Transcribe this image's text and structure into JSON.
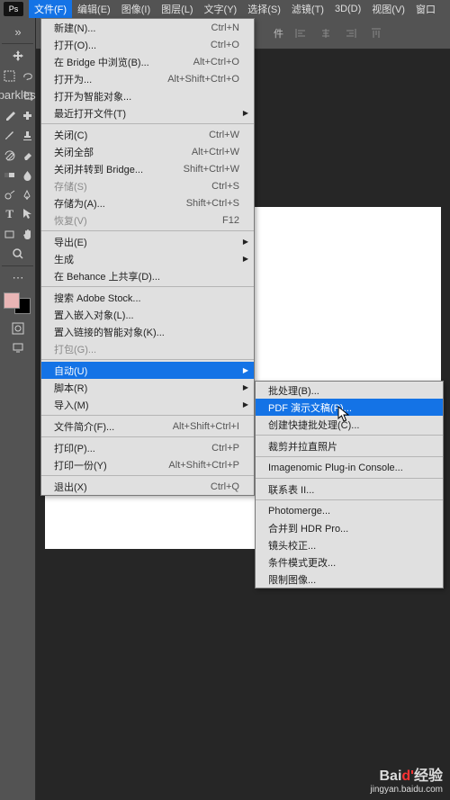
{
  "menubar": {
    "logo": "Ps",
    "items": [
      "文件(F)",
      "编辑(E)",
      "图像(I)",
      "图层(L)",
      "文字(Y)",
      "选择(S)",
      "滤镜(T)",
      "3D(D)",
      "视图(V)",
      "窗口"
    ]
  },
  "toolbar": {
    "chinese_label": "件"
  },
  "file_menu": {
    "new": {
      "label": "新建(N)...",
      "sc": "Ctrl+N"
    },
    "open": {
      "label": "打开(O)...",
      "sc": "Ctrl+O"
    },
    "browse_bridge": {
      "label": "在 Bridge 中浏览(B)...",
      "sc": "Alt+Ctrl+O"
    },
    "open_as": {
      "label": "打开为...",
      "sc": "Alt+Shift+Ctrl+O"
    },
    "open_smart": {
      "label": "打开为智能对象..."
    },
    "open_recent": {
      "label": "最近打开文件(T)"
    },
    "close": {
      "label": "关闭(C)",
      "sc": "Ctrl+W"
    },
    "close_all": {
      "label": "关闭全部",
      "sc": "Alt+Ctrl+W"
    },
    "close_goto_bridge": {
      "label": "关闭并转到 Bridge...",
      "sc": "Shift+Ctrl+W"
    },
    "save": {
      "label": "存储(S)",
      "sc": "Ctrl+S"
    },
    "save_as": {
      "label": "存储为(A)...",
      "sc": "Shift+Ctrl+S"
    },
    "revert": {
      "label": "恢复(V)",
      "sc": "F12"
    },
    "export": {
      "label": "导出(E)"
    },
    "generate": {
      "label": "生成"
    },
    "behance": {
      "label": "在 Behance 上共享(D)..."
    },
    "search_stock": {
      "label": "搜索 Adobe Stock..."
    },
    "place_embed": {
      "label": "置入嵌入对象(L)..."
    },
    "place_linked": {
      "label": "置入链接的智能对象(K)..."
    },
    "package": {
      "label": "打包(G)..."
    },
    "automate": {
      "label": "自动(U)"
    },
    "scripts": {
      "label": "脚本(R)"
    },
    "import": {
      "label": "导入(M)"
    },
    "file_info": {
      "label": "文件简介(F)...",
      "sc": "Alt+Shift+Ctrl+I"
    },
    "print": {
      "label": "打印(P)...",
      "sc": "Ctrl+P"
    },
    "print_one": {
      "label": "打印一份(Y)",
      "sc": "Alt+Shift+Ctrl+P"
    },
    "exit": {
      "label": "退出(X)",
      "sc": "Ctrl+Q"
    }
  },
  "automate_submenu": {
    "batch": "批处理(B)...",
    "pdf": "PDF 演示文稿(P)...",
    "create_droplet": "创建快捷批处理(C)...",
    "crop_straighten": "裁剪并拉直照片",
    "imagenomic": "Imagenomic Plug-in Console...",
    "contact_sheet": "联系表 II...",
    "photomerge": "Photomerge...",
    "merge_hdr": "合并到 HDR Pro...",
    "lens_correction": "镜头校正...",
    "conditional_mode": "条件模式更改...",
    "fit_image": "限制图像..."
  },
  "watermark": {
    "brand_prefix": "Bai",
    "brand_red": "d'",
    "brand_suffix": "经验",
    "url": "jingyan.baidu.com"
  }
}
